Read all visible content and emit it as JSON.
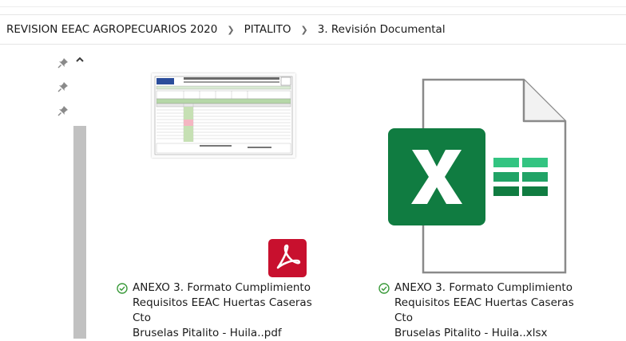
{
  "breadcrumb": {
    "items": [
      "REVISION EEAC AGROPECUARIOS 2020",
      "PITALITO",
      "3. Revisión Documental"
    ],
    "separator_icon": "chevron-right-icon"
  },
  "sidebar": {
    "pins": [
      "pin-icon",
      "pin-icon",
      "pin-icon"
    ],
    "scroll_up_icon": "chevron-up-icon"
  },
  "files": [
    {
      "name_line1": "ANEXO 3. Formato Cumplimiento",
      "name_line2": "Requisitos EEAC Huertas Caseras Cto",
      "name_line3": "Bruselas Pitalito - Huila..pdf",
      "status_icon": "sync-ok-icon",
      "type_icon": "acrobat-pdf-icon"
    },
    {
      "name_line1": "ANEXO 3. Formato Cumplimiento",
      "name_line2": "Requisitos EEAC Huertas Caseras Cto",
      "name_line3": "Bruselas Pitalito - Huila..xlsx",
      "status_icon": "sync-ok-icon",
      "type_icon": "excel-icon"
    }
  ],
  "colors": {
    "pdf_red": "#c8102e",
    "excel_green_dark": "#107c41",
    "excel_green_light": "#33c481",
    "status_green": "#3a9a3a",
    "scroll_thumb": "#c1c1c1"
  }
}
